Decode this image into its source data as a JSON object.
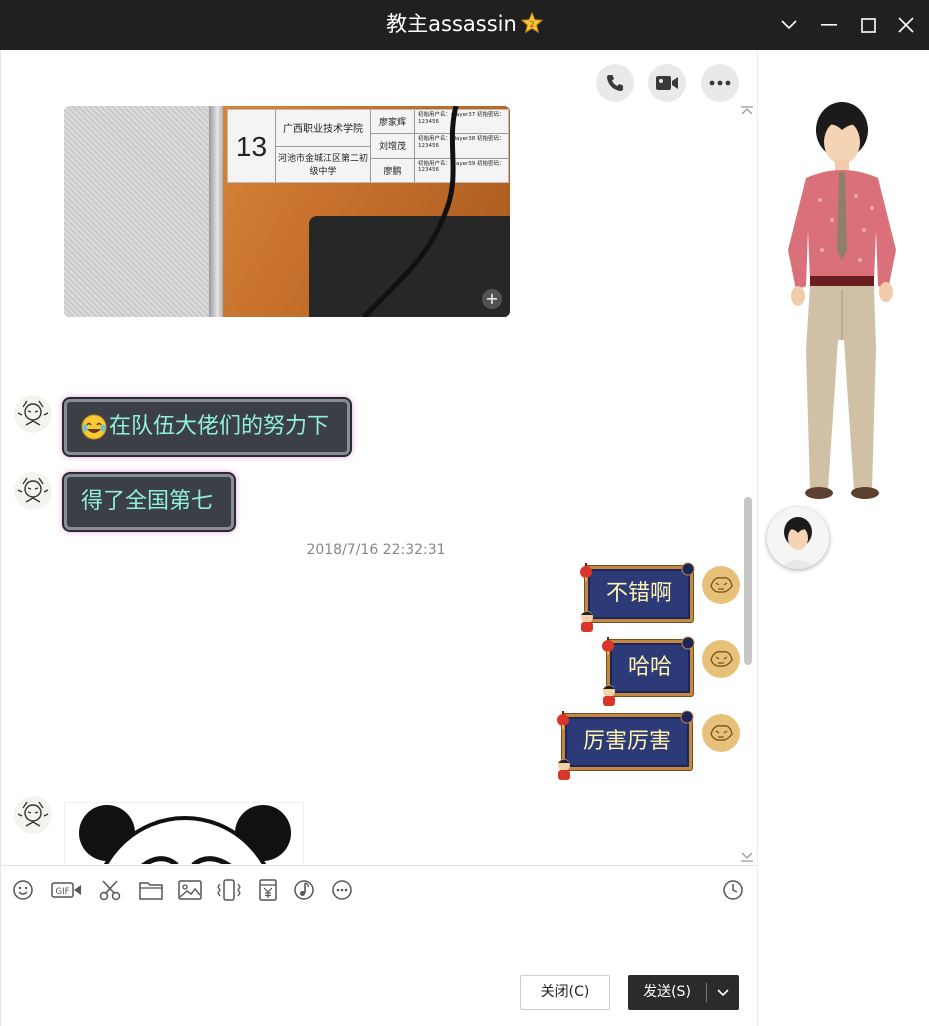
{
  "window": {
    "title": "教主assassin",
    "vip_badge": "vip-star-icon",
    "controls": [
      "chevron-down-icon",
      "minimize-icon",
      "maximize-icon",
      "close-icon"
    ]
  },
  "header_actions": [
    "phone-icon",
    "video-call-icon",
    "more-icon"
  ],
  "photo": {
    "plate": {
      "number": "13",
      "school": "广西职业技术学院",
      "school2": "河池市金城江区第二初级中学",
      "names": [
        "廖家辉",
        "刘增茂",
        "廖鹏"
      ],
      "creds": [
        "初始用户名：player37 初始密码：123456",
        "初始用户名：player38 初始密码：123456",
        "初始用户名：player39 初始密码：123456"
      ]
    }
  },
  "messages": {
    "m1": {
      "text": "在队伍大佬们的努力下",
      "emoji": "tears-of-joy-emoji"
    },
    "m2": {
      "text": "得了全国第七"
    },
    "timestamp": "2018/7/16 22:32:31",
    "m3": {
      "text": "不错啊"
    },
    "m4": {
      "text": "哈哈"
    },
    "m5": {
      "text": "厉害厉害"
    }
  },
  "toolbar": {
    "gif_label": "GIF",
    "tools": [
      "emoji-icon",
      "gif-icon",
      "scissors-icon",
      "folder-icon",
      "image-icon",
      "shake-icon",
      "red-packet-icon",
      "music-icon",
      "more-icon",
      "history-clock-icon"
    ]
  },
  "buttons": {
    "close": "关闭(C)",
    "send": "发送(S)"
  },
  "colors": {
    "titlebar": "#202020",
    "received_text": "#8ff0dd",
    "sent_text": "#fff3b0",
    "sent_bg": "#2c3a78",
    "send_button": "#2b2b2b"
  }
}
